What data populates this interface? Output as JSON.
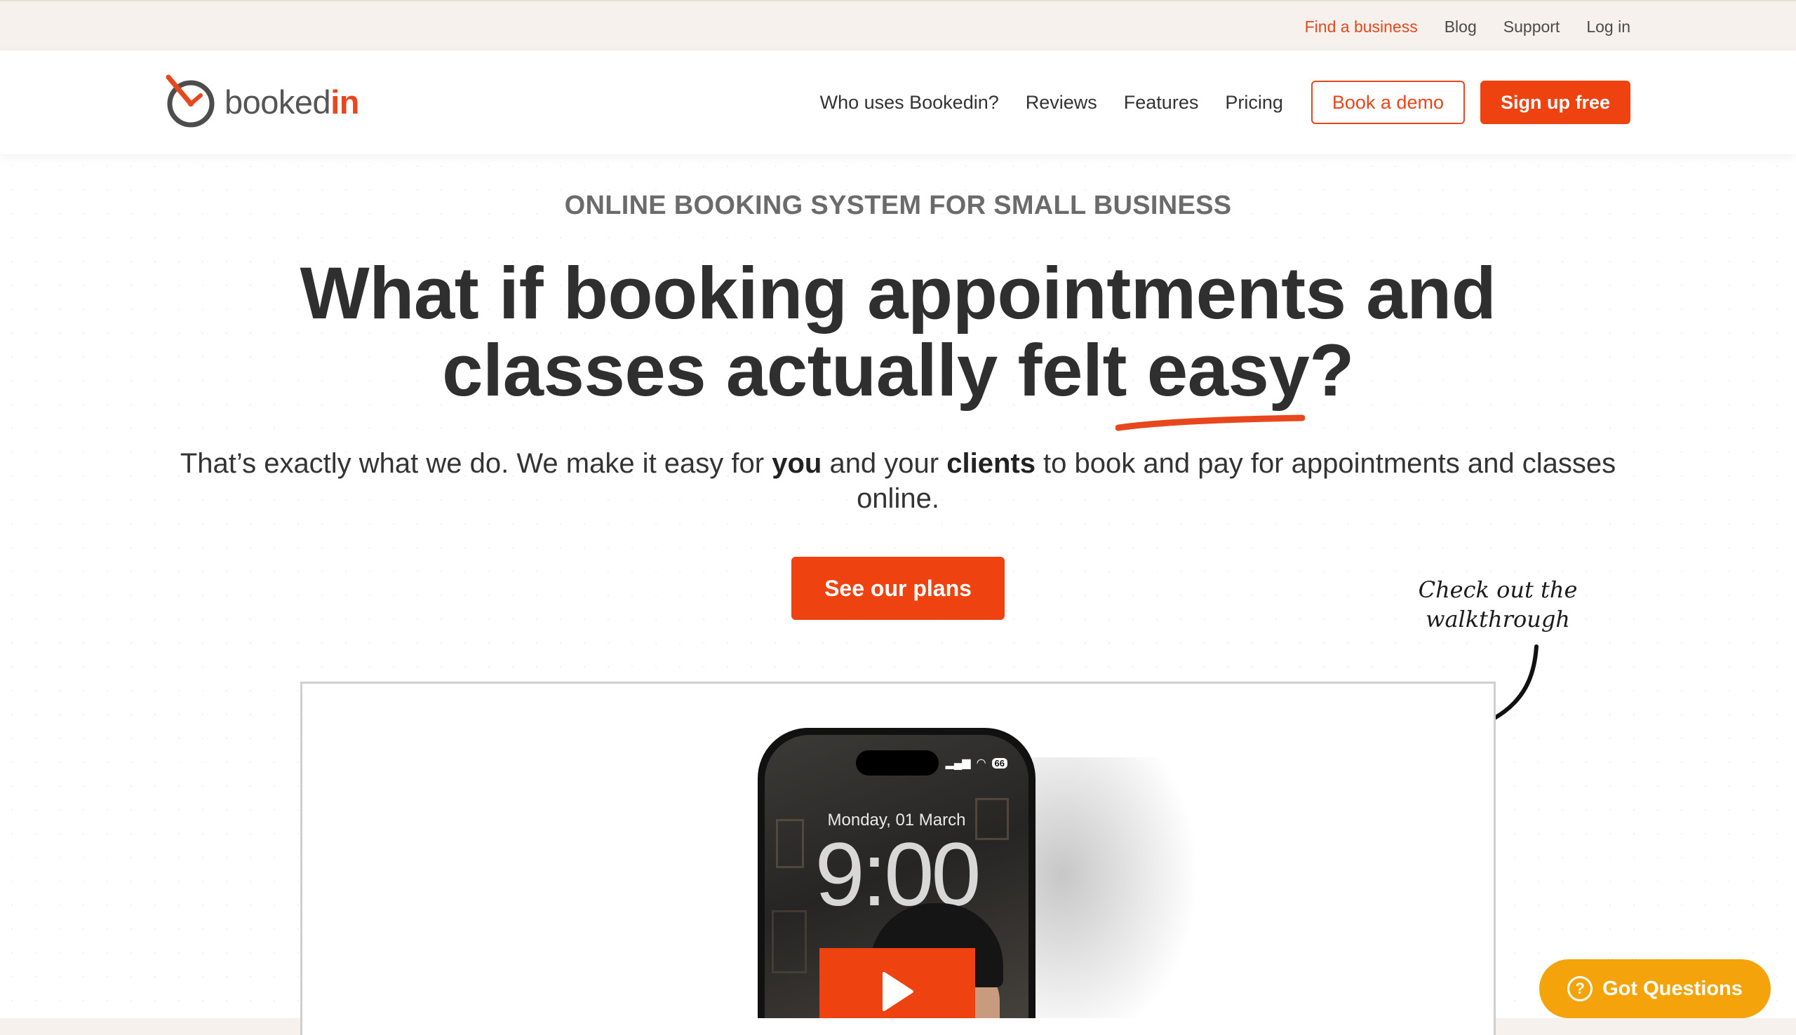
{
  "utility_nav": {
    "find_business": "Find a business",
    "blog": "Blog",
    "support": "Support",
    "login": "Log in"
  },
  "brand": {
    "name_prefix": "booked",
    "name_suffix": "in",
    "accent_color": "#ee4210"
  },
  "main_nav": {
    "who_uses": "Who uses Bookedin?",
    "reviews": "Reviews",
    "features": "Features",
    "pricing": "Pricing",
    "book_demo": "Book a demo",
    "sign_up": "Sign up free"
  },
  "hero": {
    "eyebrow": "ONLINE BOOKING SYSTEM FOR SMALL BUSINESS",
    "headline_line1": "What if booking appointments and",
    "headline_line2_start": "classes actually felt ",
    "headline_emphasis": "easy",
    "headline_end": "?",
    "sub_1": "That’s exactly what we do. We make it easy for ",
    "sub_you": "you",
    "sub_2": " and your ",
    "sub_clients": "clients",
    "sub_3": " to book and pay for appointments and classes online.",
    "cta": "See our plans",
    "walkthrough_line1": "Check out the",
    "walkthrough_line2": "walkthrough"
  },
  "video": {
    "lock_date": "Monday, 01 March",
    "lock_time": "9:00",
    "battery": "66"
  },
  "help_widget": {
    "label": "Got Questions"
  }
}
